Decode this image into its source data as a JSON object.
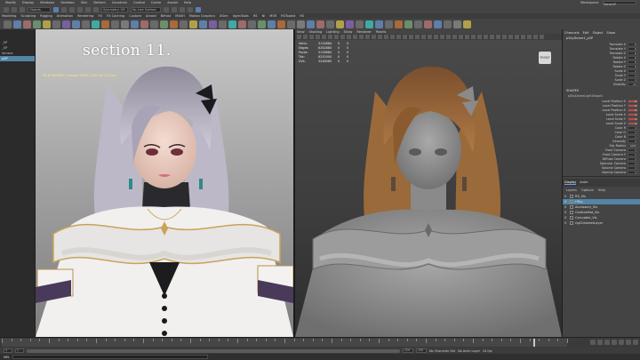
{
  "menu": [
    "Modify",
    "Display",
    "Windows",
    "Skeleton",
    "Skin",
    "Deform",
    "Constrain",
    "Control",
    "Cache",
    "Arnold",
    "Help"
  ],
  "workspace": {
    "label": "Workspace:",
    "value": "General*"
  },
  "statusline": {
    "mode": "Objects",
    "symmetry": "Symmetry: Off",
    "live": "No Live Surface"
  },
  "shelf_tabs": [
    {
      "label": "Modeling",
      "active": false
    },
    {
      "label": "Sculpting",
      "active": false
    },
    {
      "label": "Rigging",
      "active": false
    },
    {
      "label": "Animation",
      "active": false
    },
    {
      "label": "Rendering",
      "active": false
    },
    {
      "label": "FX",
      "active": false
    },
    {
      "label": "FX Caching",
      "active": false
    },
    {
      "label": "Custom",
      "active": false
    },
    {
      "label": "Arnold",
      "active": false
    },
    {
      "label": "Bifrost",
      "active": false
    },
    {
      "label": "MASH",
      "active": false
    },
    {
      "label": "Motion Graphics",
      "active": false
    },
    {
      "label": "XGen",
      "active": false
    },
    {
      "label": "XgenTools",
      "active": false
    },
    {
      "label": "RS",
      "active": false
    },
    {
      "label": "Ni",
      "active": false
    },
    {
      "label": "MSR",
      "active": false
    },
    {
      "label": "RSToolkit",
      "active": false
    },
    {
      "label": "RS",
      "active": false
    }
  ],
  "shelf_tool_colors": [
    "#6a6a6a",
    "#5e7fa8",
    "#9c6b6b",
    "#6b8f6b",
    "#b0a04a",
    "#6a6a6a",
    "#7a5fa0",
    "#5e7fa8",
    "#6a6a6a",
    "#3fa9a4",
    "#a86a3a",
    "#6a6a6a",
    "#7a7a7a",
    "#5e7fa8",
    "#9c6b6b",
    "#6a6a6a",
    "#6b8f6b",
    "#a86a3a",
    "#6a6a6a",
    "#b0a04a",
    "#5e7fa8",
    "#7a5fa0",
    "#6a6a6a",
    "#3fa9a4",
    "#9c6b6b",
    "#6a6a6a",
    "#6b8f6b",
    "#5e7fa8",
    "#a86a3a",
    "#6a6a6a",
    "#7a7a7a",
    "#5e7fa8",
    "#9c6b6b",
    "#6a6a6a",
    "#b0a04a",
    "#7a5fa0",
    "#6a6a6a",
    "#3fa9a4",
    "#5e7fa8",
    "#6a6a6a",
    "#a86a3a",
    "#6b8f6b",
    "#6a6a6a",
    "#9c6b6b",
    "#5e7fa8",
    "#6a6a6a",
    "#7a7a7a",
    "#b0a04a"
  ],
  "outliner": [
    {
      "label": "",
      "sel": false
    },
    {
      "label": "",
      "sel": false
    },
    {
      "label": "_SP",
      "sel": false
    },
    {
      "label": "_SP",
      "sel": false
    },
    {
      "label": "lamera",
      "sel": false
    },
    {
      "label": "pSP",
      "sel": true
    },
    {
      "label": "",
      "sel": false
    },
    {
      "label": "",
      "sel": false
    },
    {
      "label": "",
      "sel": false
    },
    {
      "label": "",
      "sel": false
    },
    {
      "label": "",
      "sel": false
    },
    {
      "label": "",
      "sel": false
    },
    {
      "label": "",
      "sel": false
    },
    {
      "label": "",
      "sel": false
    },
    {
      "label": "",
      "sel": false
    },
    {
      "label": "",
      "sel": false
    },
    {
      "label": "",
      "sel": false
    }
  ],
  "overlay_title": "section 11.",
  "left_vp": {
    "info": "38.4k RENDER | sample 3/256 | 0:02:36 | 0.0 sec"
  },
  "right_vp": {
    "menus": [
      "View",
      "Shading",
      "Lighting",
      "Show",
      "Renderer",
      "Panels"
    ],
    "hud": [
      {
        "k": "Verts:",
        "v": "3134884",
        "c1": "0",
        "c2": "0"
      },
      {
        "k": "Edges:",
        "v": "6262880",
        "c1": "0",
        "c2": "0"
      },
      {
        "k": "Faces:",
        "v": "3128684",
        "c1": "0",
        "c2": "0"
      },
      {
        "k": "Tris:",
        "v": "6252000",
        "c1": "0",
        "c2": "0"
      },
      {
        "k": "UVs:",
        "v": "3248085",
        "c1": "0",
        "c2": "0"
      }
    ],
    "cube_label": "FRONT"
  },
  "channel_box": {
    "tabs": [
      "Channels",
      "Edit",
      "Object",
      "Show"
    ],
    "object": "pSkyDome1_pSP",
    "channels": [
      {
        "name": "Translate X",
        "value": "0"
      },
      {
        "name": "Translate Y",
        "value": "0"
      },
      {
        "name": "Translate Z",
        "value": "0"
      },
      {
        "name": "Rotate X",
        "value": "0"
      },
      {
        "name": "Rotate Y",
        "value": "0"
      },
      {
        "name": "Rotate Z",
        "value": "0"
      },
      {
        "name": "Scale X",
        "value": "1"
      },
      {
        "name": "Scale Y",
        "value": "1"
      },
      {
        "name": "Scale Z",
        "value": "1"
      },
      {
        "name": "Visibility",
        "value": "on"
      }
    ],
    "shapes_label": "SHAPES",
    "shape_name": "pSkyDomeLightShape1",
    "shape_channels": [
      {
        "name": "Local Position X",
        "value": "0",
        "red": true
      },
      {
        "name": "Local Position Y",
        "value": "0",
        "red": true
      },
      {
        "name": "Local Position Z",
        "value": "0",
        "red": true
      },
      {
        "name": "Local Scale X",
        "value": "1",
        "red": true
      },
      {
        "name": "Local Scale Y",
        "value": "1",
        "red": true
      },
      {
        "name": "Local Scale Z",
        "value": "1",
        "red": true
      },
      {
        "name": "Color R",
        "value": "1",
        "red": false
      },
      {
        "name": "Color G",
        "value": "1",
        "red": false
      },
      {
        "name": "Color B",
        "value": "1",
        "red": false
      },
      {
        "name": "Intensity",
        "value": "1",
        "red": false
      },
      {
        "name": "Sky Radius",
        "value": "1000",
        "red": false
      },
      {
        "name": "Front Camera",
        "value": "1",
        "red": false
      },
      {
        "name": "Front Camera Y",
        "value": "1",
        "red": false
      },
      {
        "name": "Diffuse Camera",
        "value": "1",
        "red": false
      },
      {
        "name": "Specular Camera",
        "value": "1",
        "red": false
      },
      {
        "name": "Volume Camera",
        "value": "1",
        "red": false
      },
      {
        "name": "Normal Camera",
        "value": "1",
        "red": false
      }
    ]
  },
  "layer_editor": {
    "tabs": [
      {
        "label": "Display",
        "active": true
      },
      {
        "label": "Anim",
        "active": false
      }
    ],
    "menus": [
      "Layers",
      "Options",
      "Help"
    ],
    "layers": [
      {
        "vis": "V",
        "name": "RS_Vis",
        "sel": false
      },
      {
        "vis": "V",
        "name": "HRig",
        "sel": true
      },
      {
        "vis": "V",
        "name": "Accessory_Vis",
        "sel": false
      },
      {
        "vis": "V",
        "name": "ClothesMat_Vis",
        "sel": false
      },
      {
        "vis": "V",
        "name": "Carryable_Vis",
        "sel": false
      },
      {
        "vis": "V",
        "name": "rigCtrlsheetLayer",
        "sel": false
      }
    ]
  },
  "timeline": {
    "playhead_frac": 0.94
  },
  "range": {
    "start": "1",
    "inner_start": "1",
    "inner_end": "120",
    "end": "120",
    "char_set": "No Character Set",
    "anim_layer": "No Anim Layer",
    "fps": "24 fps"
  },
  "cmd": {
    "label": "MEL"
  }
}
